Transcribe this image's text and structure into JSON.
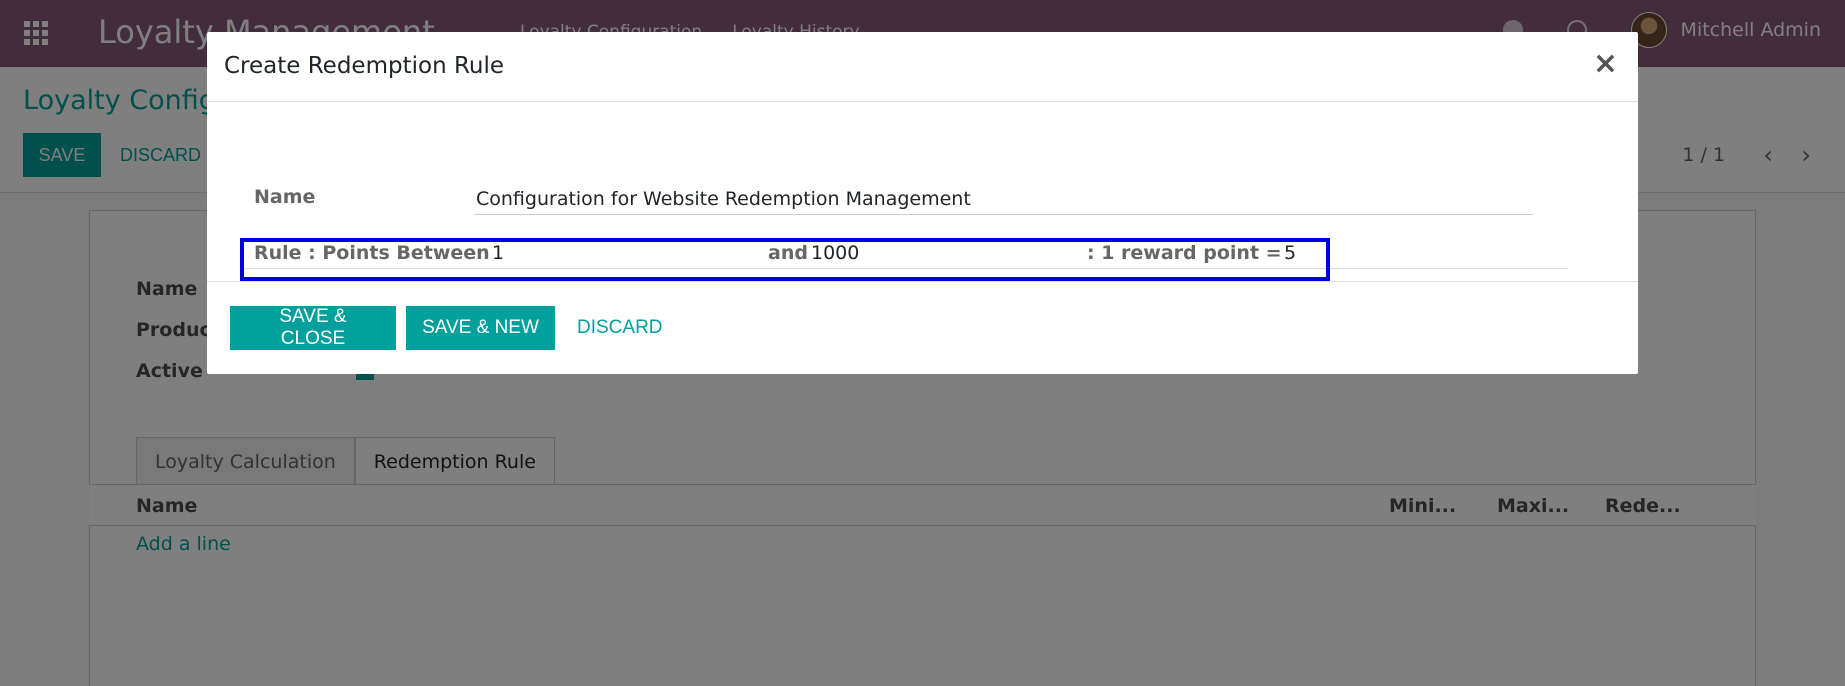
{
  "navbar": {
    "app_title": "Loyalty Management",
    "menu": [
      "Loyalty Configuration",
      "Loyalty History"
    ],
    "user_name": "Mitchell Admin"
  },
  "control_panel": {
    "breadcrumb": "Loyalty Configuration",
    "save_label": "SAVE",
    "discard_label": "DISCARD",
    "pager": "1 / 1"
  },
  "form": {
    "labels": {
      "name": "Name",
      "product": "Product",
      "active": "Active"
    },
    "tabs": [
      "Loyalty Calculation",
      "Redemption Rule"
    ],
    "table_headers": [
      "Name",
      "Mini...",
      "Maxi...",
      "Rede..."
    ],
    "add_line": "Add a line"
  },
  "modal": {
    "title": "Create Redemption Rule",
    "close": "×",
    "name_label": "Name",
    "name_value": "Configuration for Website Redemption Management",
    "rule_label": "Rule : Points Between",
    "min_points": "1",
    "and_label": "and",
    "max_points": "1000",
    "reward_label": ": 1 reward point =",
    "reward_value": "5",
    "buttons": {
      "save_close": "SAVE & CLOSE",
      "save_new": "SAVE & NEW",
      "discard": "DISCARD"
    }
  },
  "colors": {
    "brand": "#875a7b",
    "accent": "#00a09d",
    "highlight": "#0000e6"
  }
}
